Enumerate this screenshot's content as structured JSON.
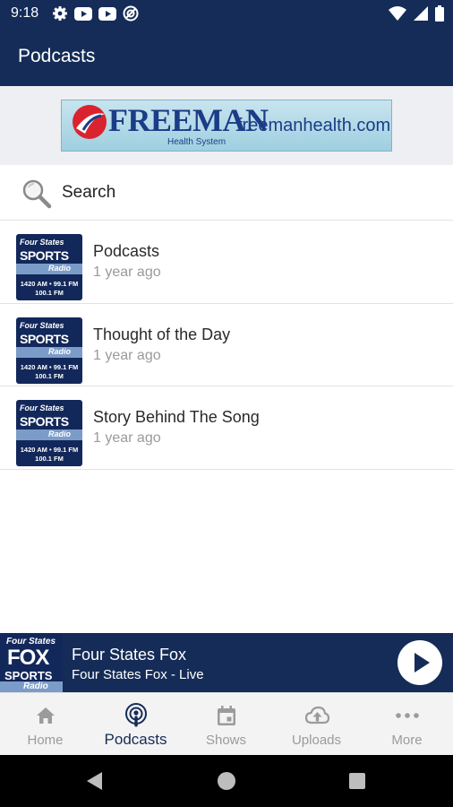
{
  "status_bar": {
    "time": "9:18",
    "left_icons": [
      "gear-icon",
      "youtube-icon",
      "youtube-icon",
      "vpn-icon"
    ],
    "right_icons": [
      "wifi-icon",
      "signal-icon",
      "battery-icon"
    ]
  },
  "app_bar": {
    "title": "Podcasts"
  },
  "banner": {
    "brand": "FREEMAN",
    "subtitle": "Health System",
    "url": "freemanhealth.com"
  },
  "search": {
    "label": "Search",
    "icon": "search-icon"
  },
  "podcasts": [
    {
      "title": "Podcasts",
      "time": "1 year ago",
      "thumb": {
        "l1": "Four States",
        "l2": "SPORTS",
        "l3": "Radio",
        "l4": "1420 AM • 99.1 FM",
        "l5": "100.1 FM"
      }
    },
    {
      "title": "Thought of the Day",
      "time": "1 year ago",
      "thumb": {
        "l1": "Four States",
        "l2": "SPORTS",
        "l3": "Radio",
        "l4": "1420 AM • 99.1 FM",
        "l5": "100.1 FM"
      }
    },
    {
      "title": "Story Behind The Song",
      "time": "1 year ago",
      "thumb": {
        "l1": "Four States",
        "l2": "SPORTS",
        "l3": "Radio",
        "l4": "1420 AM • 99.1 FM",
        "l5": "100.1 FM"
      }
    }
  ],
  "player": {
    "thumb": {
      "l1": "Four States",
      "l2": "FOX",
      "l3": "SPORTS",
      "l4": "Radio"
    },
    "title": "Four States Fox",
    "subtitle": "Four States Fox - Live",
    "button_icon": "play-icon"
  },
  "tabs": [
    {
      "label": "Home",
      "icon": "home-icon",
      "active": false
    },
    {
      "label": "Podcasts",
      "icon": "podcast-icon",
      "active": true
    },
    {
      "label": "Shows",
      "icon": "calendar-icon",
      "active": false
    },
    {
      "label": "Uploads",
      "icon": "cloud-upload-icon",
      "active": false
    },
    {
      "label": "More",
      "icon": "more-icon",
      "active": false
    }
  ],
  "colors": {
    "brand_navy": "#152c58",
    "inactive_tab": "#9b9b9b",
    "subtitle_gray": "#9a9a9a"
  }
}
